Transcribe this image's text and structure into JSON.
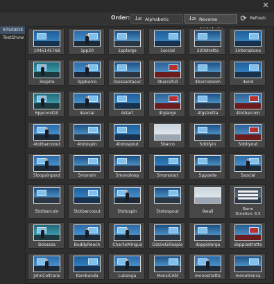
{
  "window": {
    "close_glyph": "✕"
  },
  "toolbar": {
    "order_label": "Order:",
    "alphabetic_label": "Alphabetic",
    "reverse_label": "Reverse Alphabetic",
    "refresh_label": "Refresh",
    "alphabetic_icon": "↓a-z",
    "reverse_icon": "↓z-a",
    "refresh_icon": "refresh-icon"
  },
  "sidebar": {
    "items": [
      {
        "label": "STUDIO3",
        "selected": true
      },
      {
        "label": "TestShow",
        "selected": false
      }
    ]
  },
  "presets": [
    {
      "label": "1045145768",
      "theme": "blue"
    },
    {
      "label": "1pp20",
      "theme": "anchor"
    },
    {
      "label": "1pplarge",
      "theme": "wide"
    },
    {
      "label": "1social",
      "theme": "blue"
    },
    {
      "label": "220stretta",
      "theme": "wide"
    },
    {
      "label": "3interazione",
      "theme": "blue"
    },
    {
      "label": "3ospite",
      "theme": "teal"
    },
    {
      "label": "3ppbarco",
      "theme": "anchor"
    },
    {
      "label": "3sessantasuc",
      "theme": "wide"
    },
    {
      "label": "4barcofull",
      "theme": "red"
    },
    {
      "label": "4barcozoom",
      "theme": "wide"
    },
    {
      "label": "4end",
      "theme": "blue"
    },
    {
      "label": "6ppcond20",
      "theme": "teal"
    },
    {
      "label": "4social",
      "theme": "anchor"
    },
    {
      "label": "4start",
      "theme": "blue"
    },
    {
      "label": "4tglargo",
      "theme": "red"
    },
    {
      "label": "4tgstretta",
      "theme": "wide"
    },
    {
      "label": "4totbarcoin",
      "theme": "red"
    },
    {
      "label": "4totbarcoout",
      "theme": "anchor"
    },
    {
      "label": "4totospin",
      "theme": "wide"
    },
    {
      "label": "4totospout",
      "theme": "blue"
    },
    {
      "label": "5barco",
      "theme": "light"
    },
    {
      "label": "5dollyin",
      "theme": "wide"
    },
    {
      "label": "5dollyout",
      "theme": "red"
    },
    {
      "label": "5loopoinpout",
      "theme": "anchor"
    },
    {
      "label": "5monoin",
      "theme": "wide"
    },
    {
      "label": "5monoloop",
      "theme": "wide"
    },
    {
      "label": "5monoout",
      "theme": "blue"
    },
    {
      "label": "5pposite",
      "theme": "wide"
    },
    {
      "label": "5social",
      "theme": "anchor"
    },
    {
      "label": "5totbarcoin",
      "theme": "wide"
    },
    {
      "label": "5totbarcoout",
      "theme": "blue"
    },
    {
      "label": "5totospin",
      "theme": "anchor"
    },
    {
      "label": "5totospout",
      "theme": "wide"
    },
    {
      "label": "9wall",
      "theme": "light"
    },
    {
      "label": "Barre\nDuration: 6.5",
      "theme": "bars"
    },
    {
      "label": "Bokassa",
      "theme": "teal"
    },
    {
      "label": "BuddyReach",
      "theme": "anchor"
    },
    {
      "label": "CharlieMingus",
      "theme": "anchor"
    },
    {
      "label": "DizzieGillespie",
      "theme": "wide"
    },
    {
      "label": "doppialarga",
      "theme": "wide"
    },
    {
      "label": "doppiastretta",
      "theme": "red"
    },
    {
      "label": "JohnColtrane",
      "theme": "anchor"
    },
    {
      "label": "Kambanda",
      "theme": "blue"
    },
    {
      "label": "Lubanga",
      "theme": "anchor"
    },
    {
      "label": "MonsiCAM",
      "theme": "wide"
    },
    {
      "label": "monostretta",
      "theme": "anchor"
    },
    {
      "label": "monotronca",
      "theme": "wide"
    }
  ],
  "colors": {
    "accent_blue": "#2f7fc4",
    "selection": "#3f4f66"
  }
}
